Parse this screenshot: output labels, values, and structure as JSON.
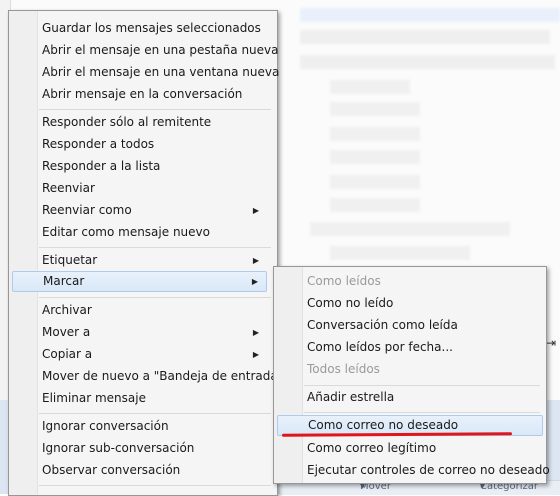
{
  "main_menu": {
    "items": [
      {
        "label": "Guardar los mensajes seleccionados"
      },
      {
        "label": "Abrir el mensaje en una pestaña nueva"
      },
      {
        "label": "Abrir el mensaje en una ventana nueva"
      },
      {
        "label": "Abrir mensaje en la conversación"
      },
      {
        "label": "Responder sólo al remitente"
      },
      {
        "label": "Responder a todos"
      },
      {
        "label": "Responder a la lista"
      },
      {
        "label": "Reenviar"
      },
      {
        "label": "Reenviar como"
      },
      {
        "label": "Editar como mensaje nuevo"
      },
      {
        "label": "Etiquetar"
      },
      {
        "label": "Marcar"
      },
      {
        "label": "Archivar"
      },
      {
        "label": "Mover a"
      },
      {
        "label": "Copiar a"
      },
      {
        "label": "Mover de nuevo a \"Bandeja de entrada\""
      },
      {
        "label": "Eliminar mensaje"
      },
      {
        "label": "Ignorar conversación"
      },
      {
        "label": "Ignorar sub-conversación"
      },
      {
        "label": "Observar conversación"
      }
    ]
  },
  "submenu": {
    "items": [
      {
        "label": "Como leídos"
      },
      {
        "label": "Como no leído"
      },
      {
        "label": "Conversación como leída"
      },
      {
        "label": "Como leídos por fecha..."
      },
      {
        "label": "Todos leídos"
      },
      {
        "label": "Añadir estrella"
      },
      {
        "label": "Como correo no deseado"
      },
      {
        "label": "Como correo legítimo"
      },
      {
        "label": "Ejecutar controles de correo no deseado"
      }
    ]
  },
  "background": {
    "toolbar": {
      "move_label": "Mover",
      "categorize_label": "Categorizar"
    },
    "annotation_color": "#e0161a"
  }
}
